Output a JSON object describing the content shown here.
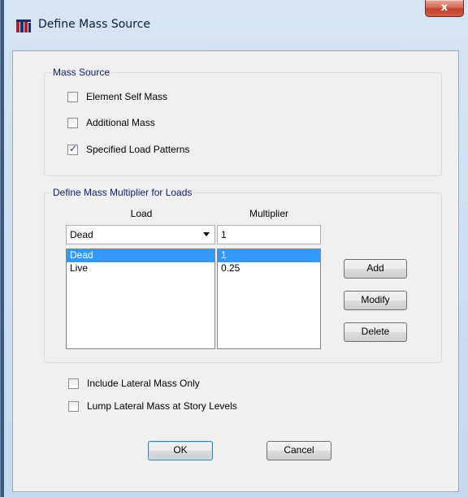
{
  "window": {
    "title": "Define Mass Source",
    "close_label": "x"
  },
  "mass_source": {
    "legend": "Mass Source",
    "options": [
      {
        "label": "Element Self Mass",
        "checked": false
      },
      {
        "label": "Additional Mass",
        "checked": false
      },
      {
        "label": "Specified Load Patterns",
        "checked": true
      }
    ]
  },
  "multiplier_group": {
    "legend": "Define Mass Multiplier for Loads",
    "load_header": "Load",
    "multiplier_header": "Multiplier",
    "load_combo_value": "Dead",
    "multiplier_input_value": "1",
    "load_list": [
      "Dead",
      "Live"
    ],
    "multiplier_list": [
      "1",
      "0.25"
    ],
    "selected_index": 0,
    "add_label": "Add",
    "modify_label": "Modify",
    "delete_label": "Delete"
  },
  "options": [
    {
      "label": "Include Lateral Mass Only",
      "checked": false
    },
    {
      "label": "Lump Lateral Mass at Story Levels",
      "checked": false
    }
  ],
  "footer": {
    "ok_label": "OK",
    "cancel_label": "Cancel"
  },
  "colors": {
    "legend_text": "#0b1d78",
    "selection": "#3399ff",
    "close_button": "#c0432b"
  }
}
